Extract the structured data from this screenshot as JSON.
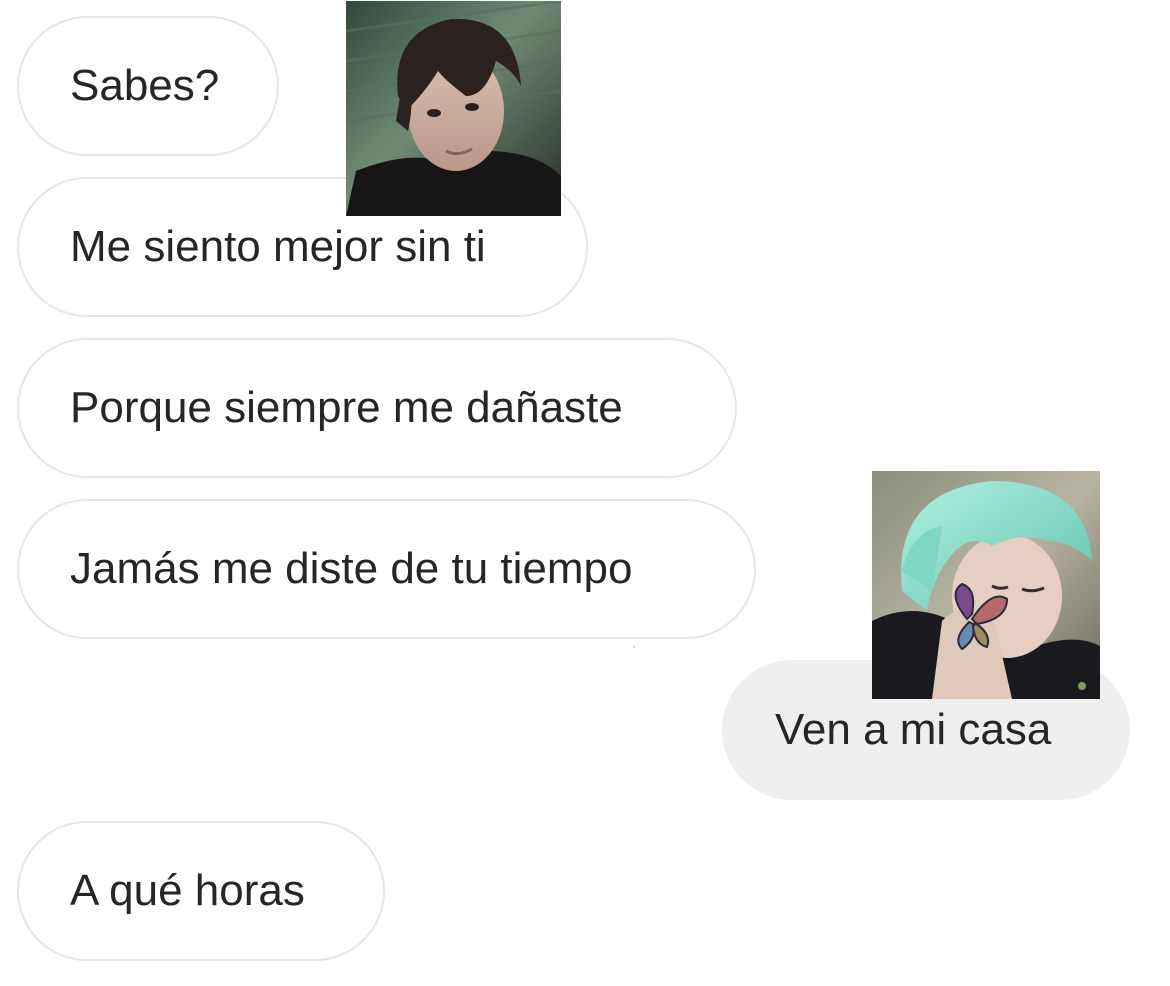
{
  "conversation": {
    "messages": [
      {
        "sender": "other",
        "text": "Sabes?"
      },
      {
        "sender": "other",
        "text": "Me siento mejor sin ti"
      },
      {
        "sender": "other",
        "text": "Porque siempre me dañaste"
      },
      {
        "sender": "other",
        "text": "Jamás me diste de tu tiempo"
      },
      {
        "sender": "me",
        "text": "Ven a mi casa"
      },
      {
        "sender": "other",
        "text": "A qué horas"
      }
    ],
    "avatars": [
      {
        "icon": "person-dark-hair-photo-icon"
      },
      {
        "icon": "person-mint-hair-butterfly-photo-icon"
      }
    ]
  },
  "colors": {
    "background": "#ffffff",
    "received_bubble_border": "#e6e6e6",
    "sent_bubble_fill": "#efefef",
    "text": "#262626"
  }
}
